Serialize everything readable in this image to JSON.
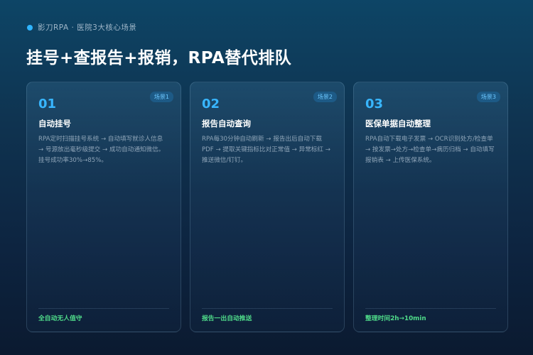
{
  "header": {
    "tag": "影刀RPA · 医院3大核心场景"
  },
  "title": "挂号+查报告+报销，RPA替代排队",
  "cards": [
    {
      "badge": "场景1",
      "num": "01",
      "title": "自动挂号",
      "desc": "RPA定时扫描挂号系统 → 自动填写就诊人信息 → 号源放出毫秒级提交 → 成功自动通知微信。挂号成功率30%→85%。",
      "footer": "全自动无人值守"
    },
    {
      "badge": "场景2",
      "num": "02",
      "title": "报告自动查询",
      "desc": "RPA每30分钟自动刷新 → 报告出后自动下载PDF → 提取关键指标比对正常值 → 异常标红 → 推送微信/钉钉。",
      "footer": "报告一出自动推送"
    },
    {
      "badge": "场景3",
      "num": "03",
      "title": "医保单据自动整理",
      "desc": "RPA自动下载电子发票 → OCR识别处方/检查单 → 按发票→处方→检查单→病历归档 → 自动填写报销表 → 上传医保系统。",
      "footer": "整理时间2h→10min"
    }
  ]
}
